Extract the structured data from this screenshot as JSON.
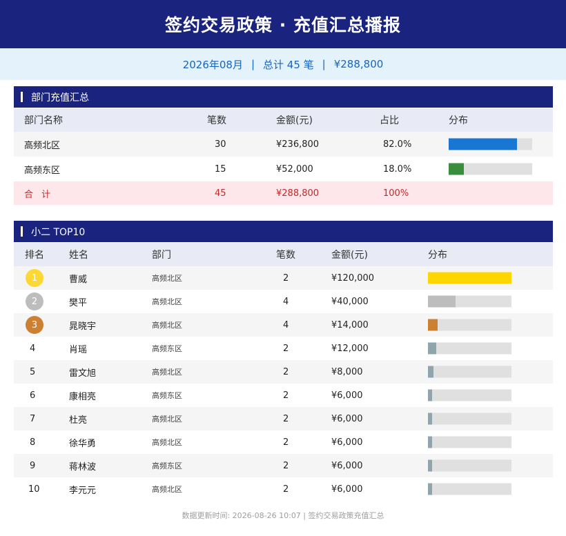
{
  "header": {
    "title": "签约交易政策 ·  充值汇总播报"
  },
  "summary": {
    "month": "2026年08月",
    "total_count": "总计 45 笔",
    "total_amount": "¥288,800",
    "separator": "|"
  },
  "dept_section": {
    "title": "部门充值汇总",
    "headers": {
      "name": "部门名称",
      "count": "笔数",
      "amount": "金额(元)",
      "ratio": "占比",
      "dist": "分布"
    },
    "rows": [
      {
        "name": "高频北区",
        "count": "30",
        "amount": "¥236,800",
        "ratio": "82.0%",
        "share": 0.82,
        "color": "#1976d2"
      },
      {
        "name": "高频东区",
        "count": "15",
        "amount": "¥52,000",
        "ratio": "18.0%",
        "share": 0.18,
        "color": "#388e3c"
      }
    ],
    "total": {
      "name": "合 计",
      "count": "45",
      "amount": "¥288,800",
      "ratio": "100%"
    }
  },
  "top_section": {
    "title": "小二 TOP10",
    "headers": {
      "rank": "排名",
      "name": "姓名",
      "dept": "部门",
      "count": "笔数",
      "amount": "金额(元)",
      "dist": "分布"
    },
    "rows": [
      {
        "rank": "1",
        "name": "曹威",
        "dept": "高频北区",
        "count": "2",
        "amount": "¥120,000",
        "share": 1.0,
        "color": "#ffd600",
        "medal": "#fdd835"
      },
      {
        "rank": "2",
        "name": "樊平",
        "dept": "高频北区",
        "count": "4",
        "amount": "¥40,000",
        "share": 0.3333,
        "color": "#bdbdbd",
        "medal": "#bdbdbd"
      },
      {
        "rank": "3",
        "name": "晁晓宇",
        "dept": "高频北区",
        "count": "4",
        "amount": "¥14,000",
        "share": 0.1167,
        "color": "#cd7f32",
        "medal": "#cd7f32"
      },
      {
        "rank": "4",
        "name": "肖瑶",
        "dept": "高频东区",
        "count": "2",
        "amount": "¥12,000",
        "share": 0.1,
        "color": "#90a4ae"
      },
      {
        "rank": "5",
        "name": "雷文旭",
        "dept": "高频北区",
        "count": "2",
        "amount": "¥8,000",
        "share": 0.0667,
        "color": "#90a4ae"
      },
      {
        "rank": "6",
        "name": "康相亮",
        "dept": "高频东区",
        "count": "2",
        "amount": "¥6,000",
        "share": 0.05,
        "color": "#90a4ae"
      },
      {
        "rank": "7",
        "name": "杜亮",
        "dept": "高频北区",
        "count": "2",
        "amount": "¥6,000",
        "share": 0.05,
        "color": "#90a4ae"
      },
      {
        "rank": "8",
        "name": "徐华勇",
        "dept": "高频北区",
        "count": "2",
        "amount": "¥6,000",
        "share": 0.05,
        "color": "#90a4ae"
      },
      {
        "rank": "9",
        "name": "蒋林波",
        "dept": "高频东区",
        "count": "2",
        "amount": "¥6,000",
        "share": 0.05,
        "color": "#90a4ae"
      },
      {
        "rank": "10",
        "name": "李元元",
        "dept": "高频北区",
        "count": "2",
        "amount": "¥6,000",
        "share": 0.05,
        "color": "#90a4ae"
      }
    ]
  },
  "footer": {
    "text": "数据更新时间: 2026-08-26 10:07  |  签约交易政策充值汇总"
  }
}
